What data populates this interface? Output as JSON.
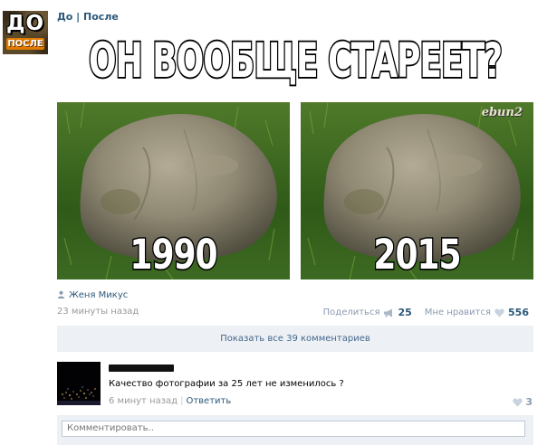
{
  "group": {
    "avatar_text_big": "ДО",
    "avatar_text_small": "ПОСЛЕ",
    "name": "До | После"
  },
  "post": {
    "headline": "ОН ВООБЩЕ СТАРЕЕТ?",
    "photos": [
      {
        "year": "1990"
      },
      {
        "year": "2015",
        "watermark": "ebun2"
      }
    ],
    "author": "Женя Микус",
    "time": "23 минуты назад",
    "share_label": "Поделиться",
    "share_count": "25",
    "like_label": "Мне нравится",
    "like_count": "556"
  },
  "comments": {
    "show_all_label": "Показать все 39 комментариев",
    "items": [
      {
        "text": "Качество фотографии за 25 лет не изменилось ?",
        "time": "6 минут назад",
        "reply_label": "Ответить",
        "like_count": "3"
      }
    ],
    "input_placeholder": "Комментировать.."
  },
  "colors": {
    "link": "#2b587a",
    "muted": "#999999",
    "panel": "#edf0f4"
  },
  "icons": {
    "author": "person-icon",
    "share": "megaphone-icon",
    "like": "heart-icon"
  }
}
